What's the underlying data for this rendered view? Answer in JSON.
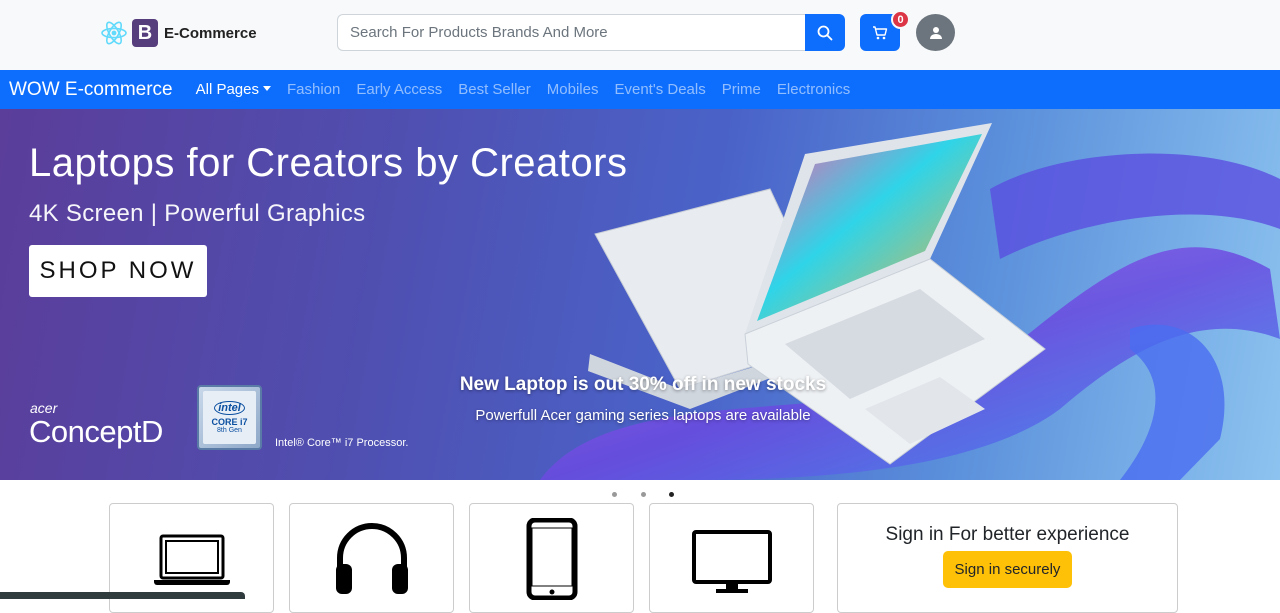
{
  "header": {
    "logo_text": "E-Commerce",
    "logo_letter": "B",
    "search_placeholder": "Search For Products Brands And More",
    "cart_count": "0"
  },
  "navbar": {
    "brand": "WOW E-commerce",
    "items": [
      {
        "label": "All Pages",
        "active": true,
        "dropdown": true
      },
      {
        "label": "Fashion"
      },
      {
        "label": "Early Access"
      },
      {
        "label": "Best Seller"
      },
      {
        "label": "Mobiles"
      },
      {
        "label": "Event's Deals"
      },
      {
        "label": "Prime"
      },
      {
        "label": "Electronics"
      }
    ]
  },
  "hero": {
    "title": "Laptops for Creators by Creators",
    "subtitle": "4K Screen | Powerful Graphics",
    "cta": "SHOP NOW",
    "brand_small": "acer",
    "brand_product": "ConceptD",
    "intel_badge_logo": "intel",
    "intel_badge_core": "CORE i7",
    "intel_badge_gen": "8th Gen",
    "intel_text": "Intel® Core™ i7 Processor.",
    "caption_title": "New Laptop is out 30% off in new stocks",
    "caption_sub": "Powerfull Acer gaming series laptops are available",
    "slides_total": 3,
    "active_slide": 3
  },
  "categories": [
    {
      "icon": "laptop-icon"
    },
    {
      "icon": "headphones-icon"
    },
    {
      "icon": "smartphone-icon"
    },
    {
      "icon": "monitor-icon"
    }
  ],
  "signin": {
    "title": "Sign in For better experience",
    "button": "Sign in securely"
  },
  "colors": {
    "primary": "#0d6efd",
    "warning": "#ffc107",
    "danger": "#dc3545",
    "logo": "#563d7c"
  }
}
